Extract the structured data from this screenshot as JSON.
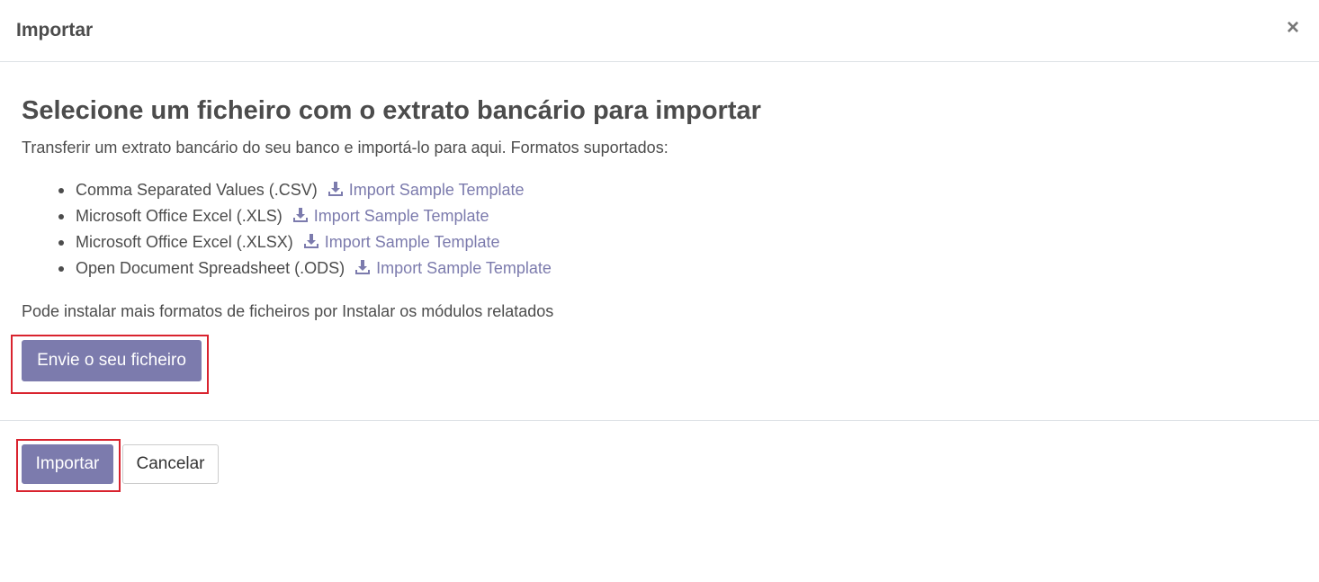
{
  "dialog": {
    "title": "Importar",
    "close_glyph": "×"
  },
  "body": {
    "heading": "Selecione um ficheiro com o extrato bancário para importar",
    "intro": "Transferir um extrato bancário do seu banco e importá-lo para aqui. Formatos suportados:",
    "formats": [
      {
        "name": "Comma Separated Values (.CSV)",
        "link": "Import Sample Template",
        "icon": "download-icon"
      },
      {
        "name": "Microsoft Office Excel (.XLS)",
        "link": "Import Sample Template",
        "icon": "download-icon"
      },
      {
        "name": "Microsoft Office Excel (.XLSX)",
        "link": "Import Sample Template",
        "icon": "download-icon"
      },
      {
        "name": "Open Document Spreadsheet (.ODS)",
        "link": "Import Sample Template",
        "icon": "download-icon"
      }
    ],
    "more_formats": "Pode instalar mais formatos de ficheiros por Instalar os módulos relatados",
    "upload_label": "Envie o seu ficheiro"
  },
  "footer": {
    "import_label": "Importar",
    "cancel_label": "Cancelar"
  },
  "colors": {
    "primary": "#7c7bad",
    "highlight": "#d9232e",
    "text": "#4c4c4c"
  }
}
